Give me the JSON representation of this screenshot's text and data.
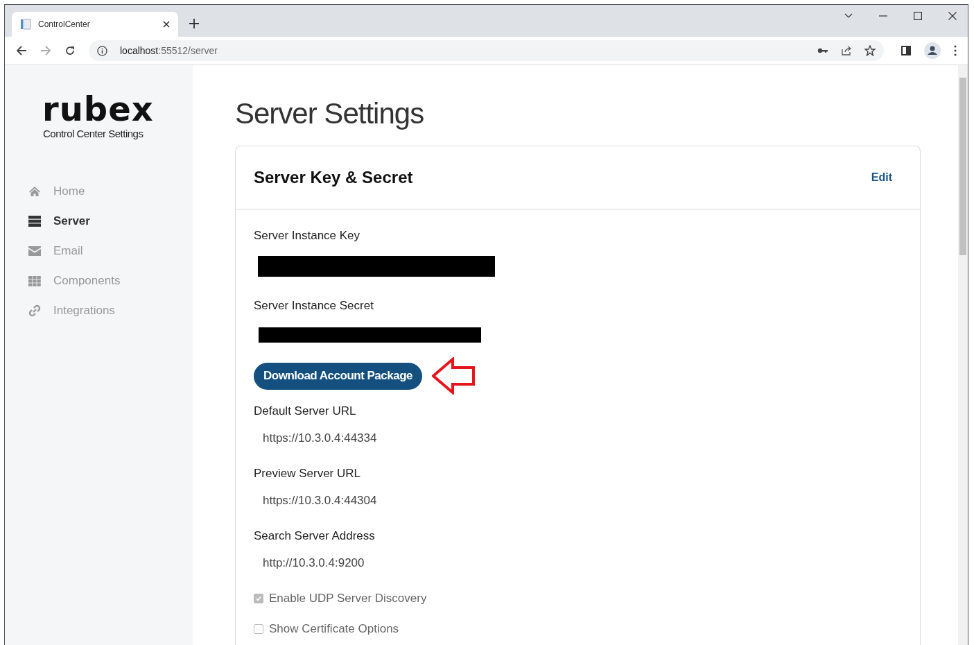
{
  "browser": {
    "tab_title": "ControlCenter",
    "url_host": "localhost",
    "url_rest": ":55512/server"
  },
  "sidebar": {
    "logo": "rubex",
    "subtitle": "Control Center Settings",
    "items": [
      {
        "label": "Home",
        "selected": false
      },
      {
        "label": "Server",
        "selected": true
      },
      {
        "label": "Email",
        "selected": false
      },
      {
        "label": "Components",
        "selected": false
      },
      {
        "label": "Integrations",
        "selected": false
      }
    ]
  },
  "page": {
    "title": "Server Settings"
  },
  "card": {
    "title": "Server Key & Secret",
    "edit": "Edit",
    "fields": [
      {
        "kind": "redacted",
        "label": "Server Instance Key"
      },
      {
        "kind": "redacted",
        "label": "Server Instance Secret"
      },
      {
        "kind": "button",
        "label": "Download Account Package",
        "highlighted": true
      },
      {
        "kind": "text",
        "label": "Default Server URL",
        "value": "https://10.3.0.4:44334"
      },
      {
        "kind": "text",
        "label": "Preview Server URL",
        "value": "https://10.3.0.4:44304"
      },
      {
        "kind": "text",
        "label": "Search Server Address",
        "value": "http://10.3.0.4:9200"
      },
      {
        "kind": "checkbox",
        "label": "Enable UDP Server Discovery",
        "checked": true,
        "disabled": true
      },
      {
        "kind": "checkbox",
        "label": "Show Certificate Options",
        "checked": false,
        "disabled": true
      }
    ]
  }
}
